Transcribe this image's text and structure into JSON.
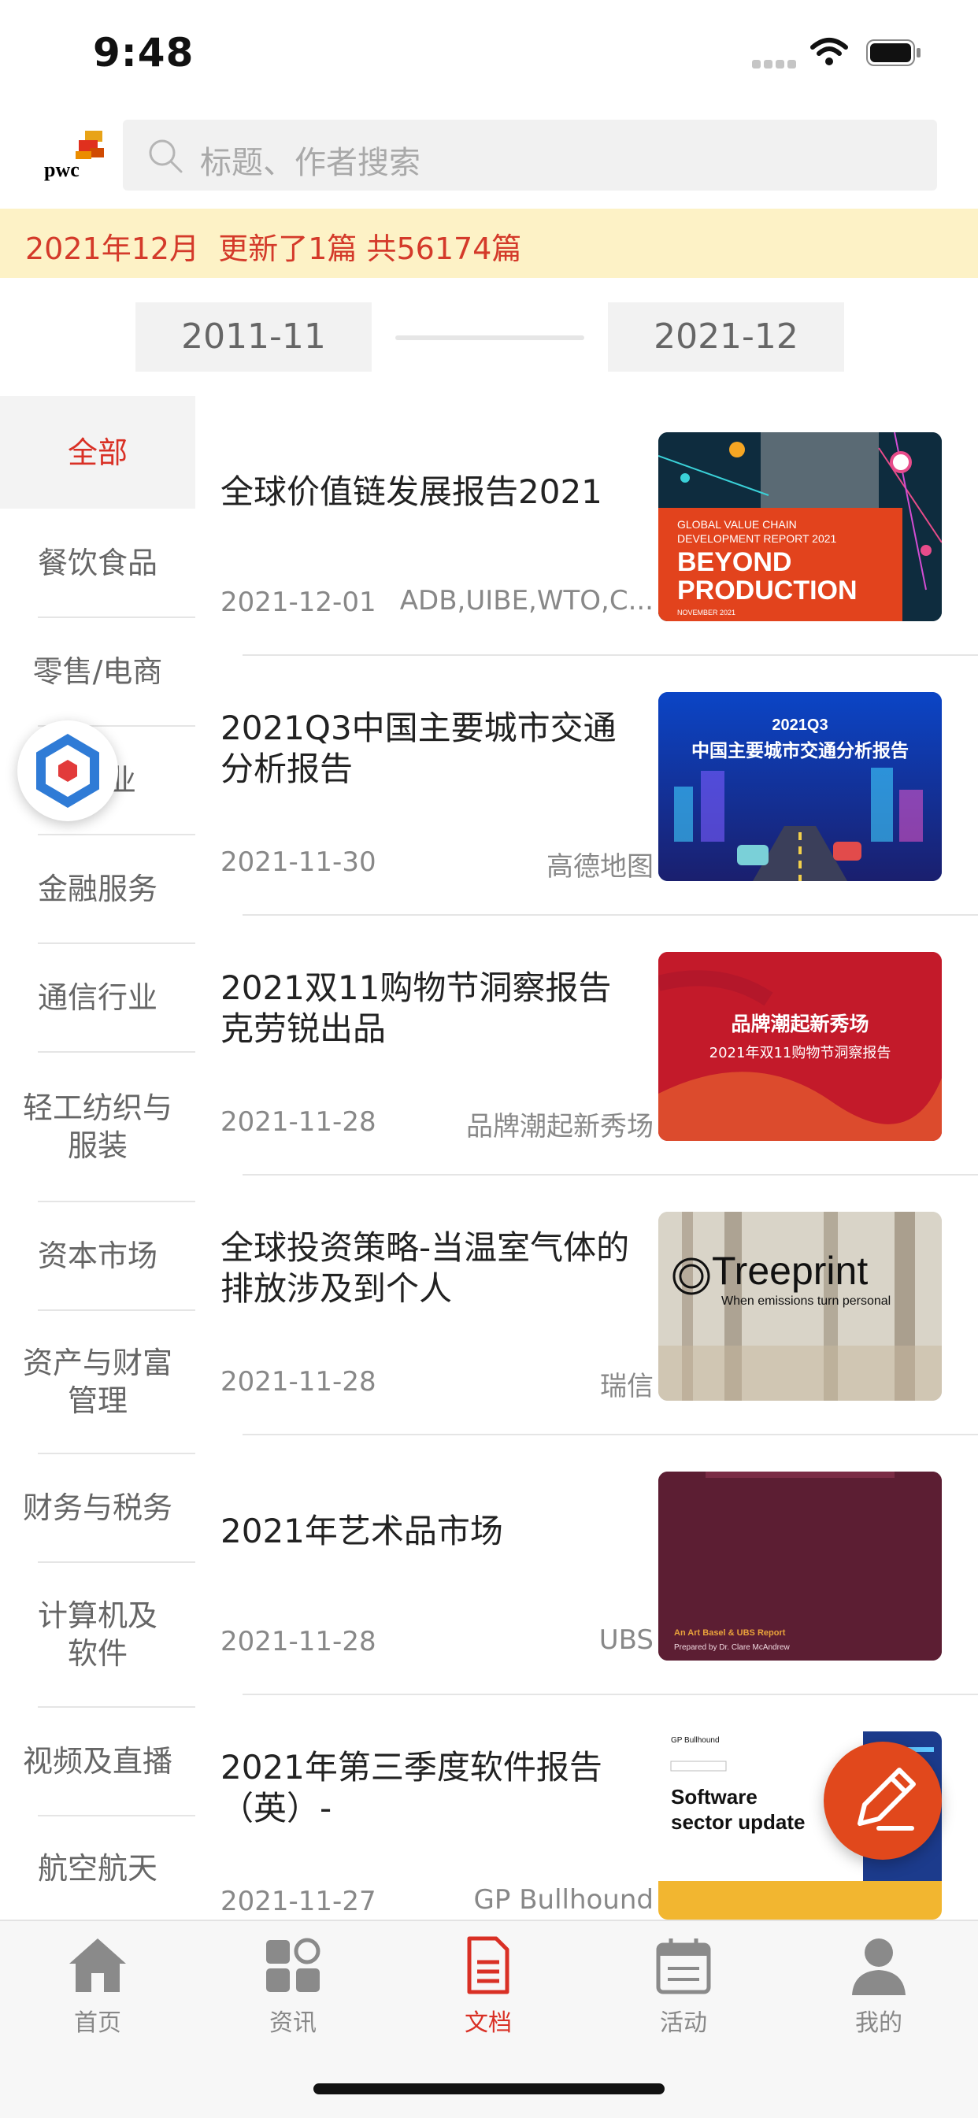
{
  "status_bar": {
    "time": "9:48"
  },
  "header": {
    "search_placeholder": "标题、作者搜索"
  },
  "banner": {
    "text": "2021年12月  更新了1篇 共56174篇"
  },
  "date_range": {
    "start": "2011-11",
    "end": "2021-12"
  },
  "categories": [
    {
      "label": "全部",
      "active": true
    },
    {
      "label": "餐饮食品"
    },
    {
      "label": "零售/电商"
    },
    {
      "label": "业"
    },
    {
      "label": "金融服务"
    },
    {
      "label": "通信行业"
    },
    {
      "label": "轻工纺织与\n服装"
    },
    {
      "label": "资本市场"
    },
    {
      "label": "资产与财富\n管理"
    },
    {
      "label": "财务与税务"
    },
    {
      "label": "计算机及\n软件"
    },
    {
      "label": "视频及直播"
    },
    {
      "label": "航空航天"
    }
  ],
  "reports": [
    {
      "title": "全球价值链发展报告2021",
      "date": "2021-12-01",
      "source": "ADB,UIBE,WTO,C...",
      "thumb": {
        "line1": "GLOBAL VALUE CHAIN",
        "line2": "DEVELOPMENT REPORT 2021",
        "big1": "BEYOND",
        "big2": "PRODUCTION",
        "small": "NOVEMBER 2021"
      }
    },
    {
      "title": "2021Q3中国主要城市交通分析报告",
      "date": "2021-11-30",
      "source": "高德地图",
      "thumb": {
        "line1": "2021Q3",
        "line2": "中国主要城市交通分析报告"
      }
    },
    {
      "title": "2021双11购物节洞察报告克劳锐出品",
      "date": "2021-11-28",
      "source": "品牌潮起新秀场",
      "thumb": {
        "line1": "品牌潮起新秀场",
        "line2": "2021年双11购物节洞察报告"
      }
    },
    {
      "title": "全球投资策略-当温室气体的排放涉及到个人",
      "date": "2021-11-28",
      "source": "瑞信",
      "thumb": {
        "line1": "Treeprint",
        "line2": "When emissions turn personal"
      }
    },
    {
      "title": "2021年艺术品市场",
      "date": "2021-11-28",
      "source": "UBS",
      "thumb": {
        "line1": "An Art Basel & UBS Report",
        "line2": "Prepared by Dr. Clare McAndrew"
      }
    },
    {
      "title": "2021年第三季度软件报告（英）-",
      "date": "2021-11-27",
      "source": "GP Bullhound",
      "thumb": {
        "line1": "GP Bullhound",
        "line2": "Software",
        "line3": "sector update"
      }
    }
  ],
  "tabbar": {
    "tabs": [
      {
        "label": "首页",
        "icon": "home-icon"
      },
      {
        "label": "资讯",
        "icon": "news-icon"
      },
      {
        "label": "文档",
        "icon": "document-icon",
        "active": true
      },
      {
        "label": "活动",
        "icon": "calendar-icon"
      },
      {
        "label": "我的",
        "icon": "profile-icon"
      }
    ]
  },
  "colors": {
    "accent": "#d93025",
    "banner_bg": "#fdf2c6",
    "fab": "#e1481c"
  }
}
